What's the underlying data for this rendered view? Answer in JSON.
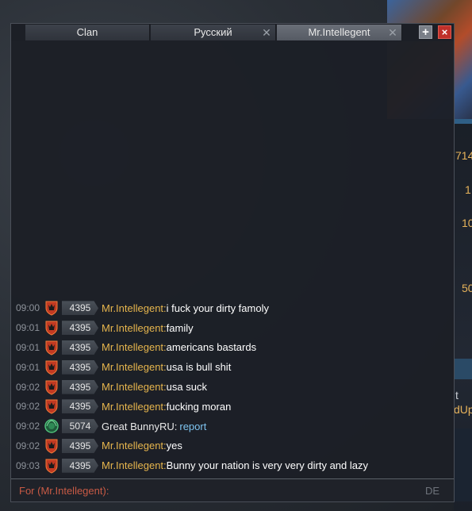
{
  "window": {
    "tabs": [
      {
        "label": "Clan"
      },
      {
        "label": "Русский"
      },
      {
        "label": "Mr.Intellegent"
      }
    ],
    "add_label": "+",
    "close_label": "×"
  },
  "background": {
    "numbers": [
      "714",
      "1",
      "10",
      "50",
      "t",
      "dUp"
    ]
  },
  "messages": [
    {
      "time": "09:00",
      "rating": "4395",
      "sender": "Mr.Intellegent:",
      "text": " i fuck your dirty famoly"
    },
    {
      "time": "09:01",
      "rating": "4395",
      "sender": "Mr.Intellegent:",
      "text": " family"
    },
    {
      "time": "09:01",
      "rating": "4395",
      "sender": "Mr.Intellegent:",
      "text": " americans bastards"
    },
    {
      "time": "09:01",
      "rating": "4395",
      "sender": "Mr.Intellegent:",
      "text": " usa is bull shit"
    },
    {
      "time": "09:02",
      "rating": "4395",
      "sender": "Mr.Intellegent:",
      "text": " usa suck"
    },
    {
      "time": "09:02",
      "rating": "4395",
      "sender": "Mr.Intellegent:",
      "text": " fucking moran"
    },
    {
      "time": "09:02",
      "rating": "5074",
      "system_text": "Great    BunnyRU:",
      "link": "report"
    },
    {
      "time": "09:02",
      "rating": "4395",
      "sender": "Mr.Intellegent:",
      "text": " yes"
    },
    {
      "time": "09:03",
      "rating": "4395",
      "sender": "Mr.Intellegent:",
      "text": " Bunny your nation is very very dirty and lazy"
    }
  ],
  "input": {
    "placeholder": "For (Mr.Intellegent):",
    "language": "DE"
  },
  "colors": {
    "sender": "#e6b54d",
    "link": "#7ec4f0",
    "placeholder": "#c85a45",
    "close_button": "#c0302a"
  },
  "icons": {
    "badge_red": "red-shield-rank-icon",
    "badge_green": "green-wreath-rank-icon"
  }
}
